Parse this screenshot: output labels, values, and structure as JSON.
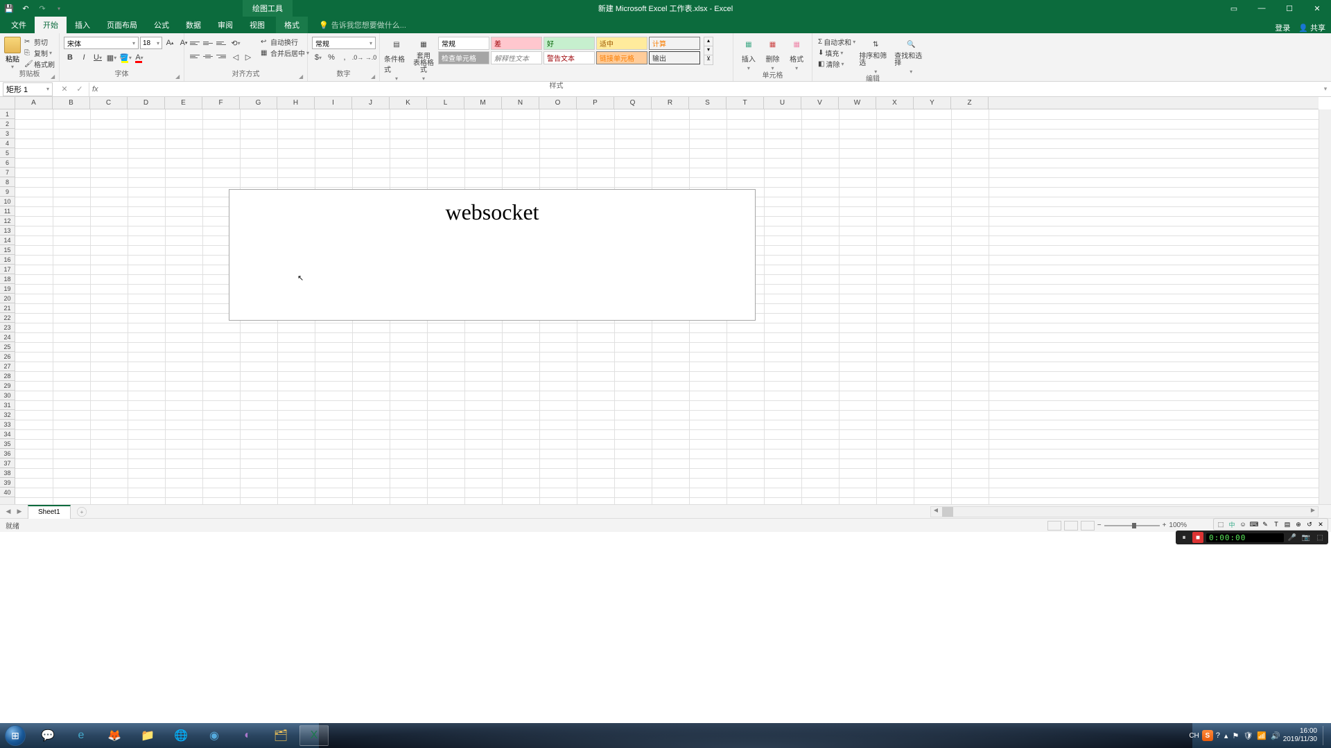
{
  "title_bar": {
    "context_tool": "绘图工具",
    "document_title": "新建 Microsoft Excel 工作表.xlsx - Excel"
  },
  "ribbon_tabs": {
    "file": "文件",
    "home": "开始",
    "insert": "插入",
    "page_layout": "页面布局",
    "formulas": "公式",
    "data": "数据",
    "review": "审阅",
    "view": "视图",
    "format": "格式",
    "tell_me": "告诉我您想要做什么...",
    "sign_in": "登录",
    "share": "共享"
  },
  "clipboard": {
    "group": "剪贴板",
    "paste": "粘贴",
    "cut": "剪切",
    "copy": "复制",
    "format_painter": "格式刷"
  },
  "font": {
    "group": "字体",
    "name": "宋体",
    "size": "18",
    "bold": "B",
    "italic": "I",
    "underline": "U"
  },
  "alignment": {
    "group": "对齐方式",
    "wrap": "自动换行",
    "merge": "合并后居中"
  },
  "number": {
    "group": "数字",
    "format": "常规"
  },
  "styles": {
    "group": "样式",
    "conditional": "条件格式",
    "table": "套用\n表格格式",
    "normal": "常规",
    "bad": "差",
    "good": "好",
    "neutral": "适中",
    "calc": "计算",
    "check": "检查单元格",
    "explain": "解释性文本",
    "warn": "警告文本",
    "linked": "链接单元格",
    "output": "输出"
  },
  "cells": {
    "group": "单元格",
    "insert": "插入",
    "delete": "删除",
    "format": "格式"
  },
  "editing": {
    "group": "编辑",
    "autosum": "自动求和",
    "fill": "填充",
    "clear": "清除",
    "sort": "排序和筛选",
    "find": "查找和选择"
  },
  "name_box": "矩形 1",
  "formula_input": "",
  "columns": [
    "A",
    "B",
    "C",
    "D",
    "E",
    "F",
    "G",
    "H",
    "I",
    "J",
    "K",
    "L",
    "M",
    "N",
    "O",
    "P",
    "Q",
    "R",
    "S",
    "T",
    "U",
    "V",
    "W",
    "X",
    "Y",
    "Z"
  ],
  "row_count": 40,
  "shape_text": "websocket",
  "sheet": {
    "name": "Sheet1",
    "status": "就绪"
  },
  "recorder": {
    "time": "0:00:00"
  },
  "taskbar": {
    "time": "16:00",
    "date": "2019/11/30",
    "ime": "CH"
  },
  "zoom": "100%"
}
